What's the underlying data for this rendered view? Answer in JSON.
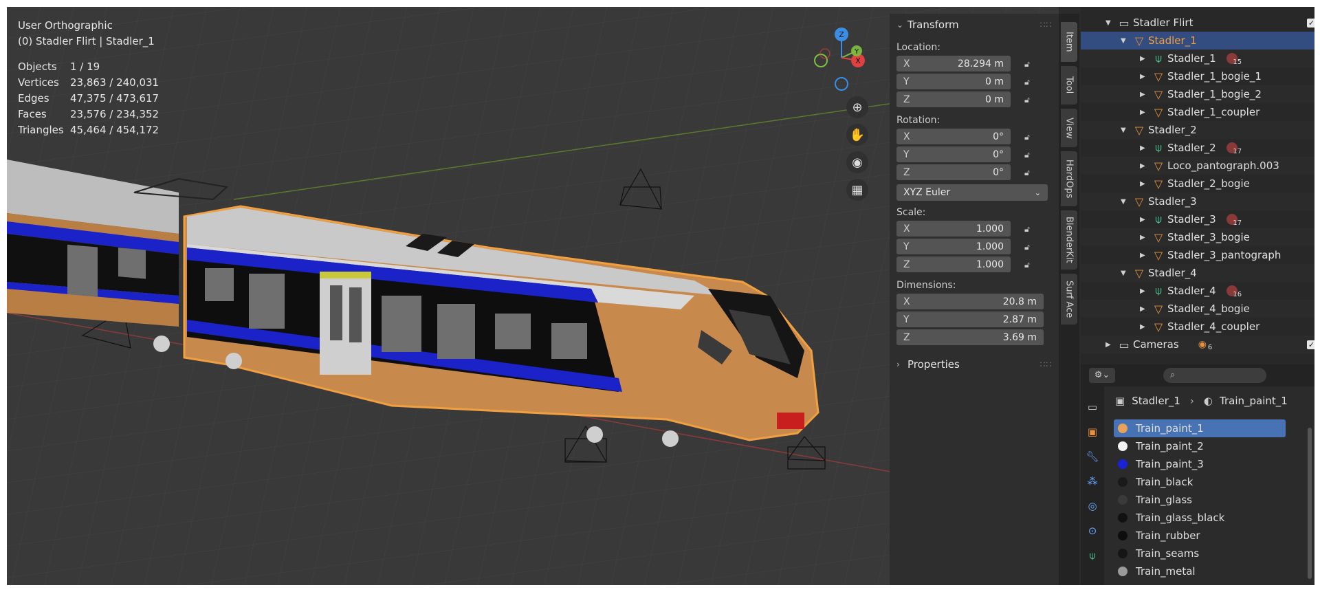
{
  "viewport": {
    "view_name": "User Orthographic",
    "context": "(0) Stadler Flirt | Stadler_1",
    "stats": [
      {
        "key": "Objects",
        "value": "1 / 19"
      },
      {
        "key": "Vertices",
        "value": "23,863 / 240,031"
      },
      {
        "key": "Edges",
        "value": "47,375 / 473,617"
      },
      {
        "key": "Faces",
        "value": "23,576 / 234,352"
      },
      {
        "key": "Triangles",
        "value": "45,464 / 454,172"
      }
    ],
    "gizmo_axes": {
      "z": "Z",
      "y": "Y",
      "x": "X"
    }
  },
  "npanel": {
    "transform_title": "Transform",
    "location_label": "Location:",
    "location": [
      {
        "axis": "X",
        "value": "28.294 m"
      },
      {
        "axis": "Y",
        "value": "0 m"
      },
      {
        "axis": "Z",
        "value": "0 m"
      }
    ],
    "rotation_label": "Rotation:",
    "rotation": [
      {
        "axis": "X",
        "value": "0°"
      },
      {
        "axis": "Y",
        "value": "0°"
      },
      {
        "axis": "Z",
        "value": "0°"
      }
    ],
    "rotation_mode": "XYZ Euler",
    "scale_label": "Scale:",
    "scale": [
      {
        "axis": "X",
        "value": "1.000"
      },
      {
        "axis": "Y",
        "value": "1.000"
      },
      {
        "axis": "Z",
        "value": "1.000"
      }
    ],
    "dimensions_label": "Dimensions:",
    "dimensions": [
      {
        "axis": "X",
        "value": "20.8 m"
      },
      {
        "axis": "Y",
        "value": "2.87 m"
      },
      {
        "axis": "Z",
        "value": "3.69 m"
      }
    ],
    "properties_title": "Properties"
  },
  "vtabs": [
    "Item",
    "Tool",
    "View",
    "HardOps",
    "BlenderKit",
    "Surf Ace"
  ],
  "outliner": {
    "rows": [
      {
        "label": "Stadler Flirt",
        "kind": "collection"
      },
      {
        "label": "Stadler_1",
        "kind": "object"
      },
      {
        "label": "Stadler_1",
        "kind": "mesh",
        "badge": "15"
      },
      {
        "label": "Stadler_1_bogie_1",
        "kind": "object"
      },
      {
        "label": "Stadler_1_bogie_2",
        "kind": "object"
      },
      {
        "label": "Stadler_1_coupler",
        "kind": "object"
      },
      {
        "label": "Stadler_2",
        "kind": "object"
      },
      {
        "label": "Stadler_2",
        "kind": "mesh",
        "badge": "17"
      },
      {
        "label": "Loco_pantograph.003",
        "kind": "object"
      },
      {
        "label": "Stadler_2_bogie",
        "kind": "object"
      },
      {
        "label": "Stadler_3",
        "kind": "object"
      },
      {
        "label": "Stadler_3",
        "kind": "mesh",
        "badge": "17"
      },
      {
        "label": "Stadler_3_bogie",
        "kind": "object"
      },
      {
        "label": "Stadler_3_pantograph",
        "kind": "object"
      },
      {
        "label": "Stadler_4",
        "kind": "object"
      },
      {
        "label": "Stadler_4",
        "kind": "mesh",
        "badge": "16"
      },
      {
        "label": "Stadler_4_bogie",
        "kind": "object"
      },
      {
        "label": "Stadler_4_coupler",
        "kind": "object"
      },
      {
        "label": "Cameras",
        "kind": "collection",
        "badge": "6"
      }
    ]
  },
  "properties": {
    "breadcrumb_object": "Stadler_1",
    "breadcrumb_material": "Train_paint_1",
    "materials": [
      {
        "name": "Train_paint_1",
        "color": "#e8a25a"
      },
      {
        "name": "Train_paint_2",
        "color": "#f2f2f2"
      },
      {
        "name": "Train_paint_3",
        "color": "#1a22d8"
      },
      {
        "name": "Train_black",
        "color": "#1a1a1a"
      },
      {
        "name": "Train_glass",
        "color": "#3a3a3a"
      },
      {
        "name": "Train_glass_black",
        "color": "#111111"
      },
      {
        "name": "Train_rubber",
        "color": "#0d0d0d"
      },
      {
        "name": "Train_seams",
        "color": "#151515"
      },
      {
        "name": "Train_metal",
        "color": "#9a9a9a"
      }
    ]
  },
  "colors": {
    "accent": "#4772b3",
    "selection": "#334d80",
    "object_orange": "#e8903a",
    "mesh_green": "#4fcf9b",
    "train_body": "#c88a4c",
    "train_stripe": "#1a22c8"
  }
}
